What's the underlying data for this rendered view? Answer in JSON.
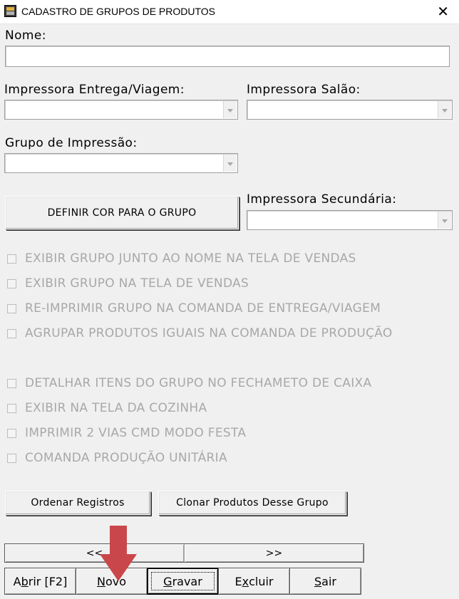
{
  "window": {
    "title": "CADASTRO DE GRUPOS DE PRODUTOS",
    "close_glyph": "✕"
  },
  "form": {
    "nome_label": "Nome:",
    "nome_value": "",
    "impressora_entrega_label": "Impressora Entrega/Viagem:",
    "impressora_entrega_value": "",
    "impressora_salao_label": "Impressora Salão:",
    "impressora_salao_value": "",
    "grupo_impressao_label": "Grupo de Impressão:",
    "grupo_impressao_value": "",
    "definir_cor_button": "DEFINIR COR PARA O GRUPO",
    "impressora_secundaria_label": "Impressora Secundária:",
    "impressora_secundaria_value": ""
  },
  "checkboxes": [
    {
      "label": "EXIBIR GRUPO JUNTO AO NOME NA TELA DE VENDAS",
      "checked": false,
      "enabled": false
    },
    {
      "label": "EXIBIR GRUPO NA TELA DE VENDAS",
      "checked": false,
      "enabled": false
    },
    {
      "label": "RE-IMPRIMIR GRUPO NA COMANDA DE ENTREGA/VIAGEM",
      "checked": false,
      "enabled": false
    },
    {
      "label": "AGRUPAR PRODUTOS IGUAIS NA COMANDA DE PRODUÇÃO",
      "checked": false,
      "enabled": false
    },
    {
      "label": "DETALHAR ITENS DO GRUPO NO FECHAMETO DE CAIXA",
      "checked": false,
      "enabled": false
    },
    {
      "label": "EXIBIR NA TELA DA COZINHA",
      "checked": false,
      "enabled": false
    },
    {
      "label": "IMPRIMIR 2 VIAS CMD MODO FESTA",
      "checked": false,
      "enabled": false
    },
    {
      "label": "COMANDA PRODUÇÃO UNITÁRIA",
      "checked": false,
      "enabled": false
    }
  ],
  "actions": {
    "ordenar": "Ordenar Registros",
    "clonar": "Clonar Produtos Desse Grupo"
  },
  "navigation": {
    "prev": "<<",
    "next": ">>"
  },
  "toolbar": {
    "abrir_pre": "A",
    "abrir_mn": "b",
    "abrir_post": "rir [F2]",
    "novo_pre": "",
    "novo_mn": "N",
    "novo_post": "ovo",
    "gravar_pre": "",
    "gravar_mn": "G",
    "gravar_post": "ravar",
    "excluir_pre": "E",
    "excluir_mn": "x",
    "excluir_post": "cluir",
    "sair_pre": "",
    "sair_mn": "S",
    "sair_post": "air"
  },
  "annotation": {
    "arrow_color": "#c9474a",
    "points_to": "Novo"
  }
}
